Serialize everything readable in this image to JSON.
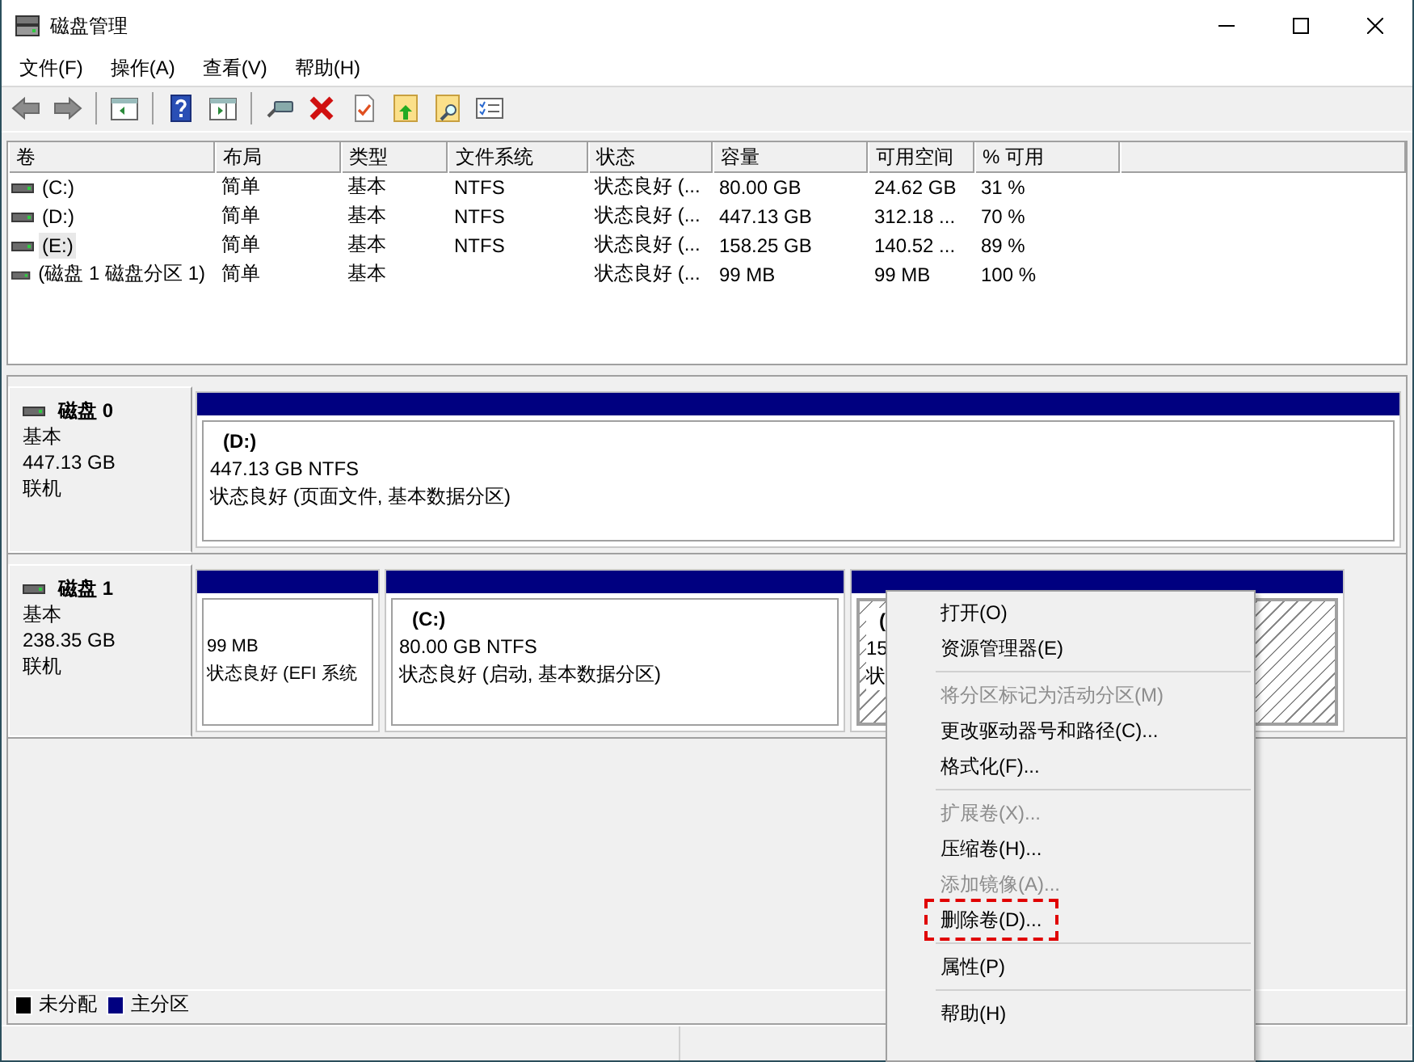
{
  "window": {
    "title": "磁盘管理"
  },
  "menu": [
    "文件(F)",
    "操作(A)",
    "查看(V)",
    "帮助(H)"
  ],
  "toolbar": [
    {
      "kind": "back"
    },
    {
      "kind": "forward"
    },
    {
      "kind": "sep"
    },
    {
      "kind": "tree"
    },
    {
      "kind": "sep"
    },
    {
      "kind": "help"
    },
    {
      "kind": "pane"
    },
    {
      "kind": "sep"
    },
    {
      "kind": "connect"
    },
    {
      "kind": "delete"
    },
    {
      "kind": "check"
    },
    {
      "kind": "folder-up"
    },
    {
      "kind": "folder-search"
    },
    {
      "kind": "list"
    }
  ],
  "volume_table": {
    "columns": [
      "卷",
      "布局",
      "类型",
      "文件系统",
      "状态",
      "容量",
      "可用空间",
      "% 可用"
    ],
    "rows": [
      {
        "selected": false,
        "cells": [
          "(C:)",
          "简单",
          "基本",
          "NTFS",
          "状态良好 (...",
          "80.00 GB",
          "24.62 GB",
          "31 %"
        ]
      },
      {
        "selected": false,
        "cells": [
          "(D:)",
          "简单",
          "基本",
          "NTFS",
          "状态良好 (...",
          "447.13 GB",
          "312.18 ...",
          "70 %"
        ]
      },
      {
        "selected": true,
        "cells": [
          "(E:)",
          "简单",
          "基本",
          "NTFS",
          "状态良好 (...",
          "158.25 GB",
          "140.52 ...",
          "89 %"
        ]
      },
      {
        "selected": false,
        "cells": [
          "(磁盘 1 磁盘分区 1)",
          "简单",
          "基本",
          "",
          "状态良好 (...",
          "99 MB",
          "99 MB",
          "100 %"
        ]
      }
    ]
  },
  "disks": [
    {
      "name": "磁盘 0",
      "type": "基本",
      "size": "447.13 GB",
      "status": "联机",
      "partitions": [
        {
          "selected": false,
          "label": "(D:)",
          "size": "447.13 GB NTFS",
          "status": "状态良好 (页面文件, 基本数据分区)"
        }
      ]
    },
    {
      "name": "磁盘 1",
      "type": "基本",
      "size": "238.35 GB",
      "status": "联机",
      "partitions": [
        {
          "selected": false,
          "size": "99 MB",
          "status": "状态良好 (EFI 系统"
        },
        {
          "selected": false,
          "label": "(C:)",
          "size": "80.00 GB NTFS",
          "status": "状态良好 (启动, 基本数据分区)"
        },
        {
          "selected": true,
          "label": "(",
          "size": "15",
          "status": "状"
        }
      ]
    }
  ],
  "legend": [
    {
      "label": "未分配",
      "color": "#000000"
    },
    {
      "label": "主分区",
      "color": "#000080"
    }
  ],
  "context_menu": [
    {
      "kind": "item",
      "label": "打开(O)",
      "disabled": false,
      "highlighted": false
    },
    {
      "kind": "item",
      "label": "资源管理器(E)",
      "disabled": false,
      "highlighted": false
    },
    {
      "kind": "separator"
    },
    {
      "kind": "item",
      "label": "将分区标记为活动分区(M)",
      "disabled": true,
      "highlighted": false
    },
    {
      "kind": "item",
      "label": "更改驱动器号和路径(C)...",
      "disabled": false,
      "highlighted": false
    },
    {
      "kind": "item",
      "label": "格式化(F)...",
      "disabled": false,
      "highlighted": false
    },
    {
      "kind": "separator"
    },
    {
      "kind": "item",
      "label": "扩展卷(X)...",
      "disabled": true,
      "highlighted": false
    },
    {
      "kind": "item",
      "label": "压缩卷(H)...",
      "disabled": false,
      "highlighted": false
    },
    {
      "kind": "item",
      "label": "添加镜像(A)...",
      "disabled": true,
      "highlighted": false
    },
    {
      "kind": "item",
      "label": "删除卷(D)...",
      "disabled": false,
      "highlighted": true
    },
    {
      "kind": "separator"
    },
    {
      "kind": "item",
      "label": "属性(P)",
      "disabled": false,
      "highlighted": false
    },
    {
      "kind": "separator"
    },
    {
      "kind": "item",
      "label": "帮助(H)",
      "disabled": false,
      "highlighted": false
    }
  ]
}
